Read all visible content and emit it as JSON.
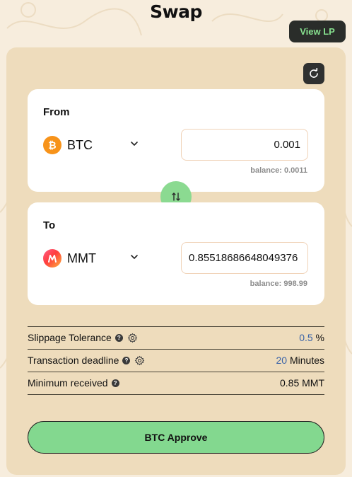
{
  "header": {
    "title": "Swap",
    "view_lp_label": "View LP"
  },
  "from": {
    "label": "From",
    "token": "BTC",
    "token_icon": "bitcoin-icon",
    "amount": "0.001",
    "balance": "balance: 0.0011"
  },
  "to": {
    "label": "To",
    "token": "MMT",
    "token_icon": "mmt-logo-icon",
    "amount": "0.85518686648049376",
    "balance": "balance: 998.99"
  },
  "settings": {
    "slippage_label": "Slippage Tolerance",
    "slippage_value": "0.5",
    "slippage_unit": "%",
    "deadline_label": "Transaction deadline",
    "deadline_value": "20",
    "deadline_unit": "Minutes",
    "min_received_label": "Minimum received",
    "min_received_value": "0.85 MMT"
  },
  "actions": {
    "approve_label": "BTC Approve"
  },
  "colors": {
    "background": "#f7eddd",
    "panel": "#eedcbc",
    "accent_green": "#83d88f",
    "accent_blue": "#3a63a8",
    "dark_button": "#2a2d2a"
  }
}
